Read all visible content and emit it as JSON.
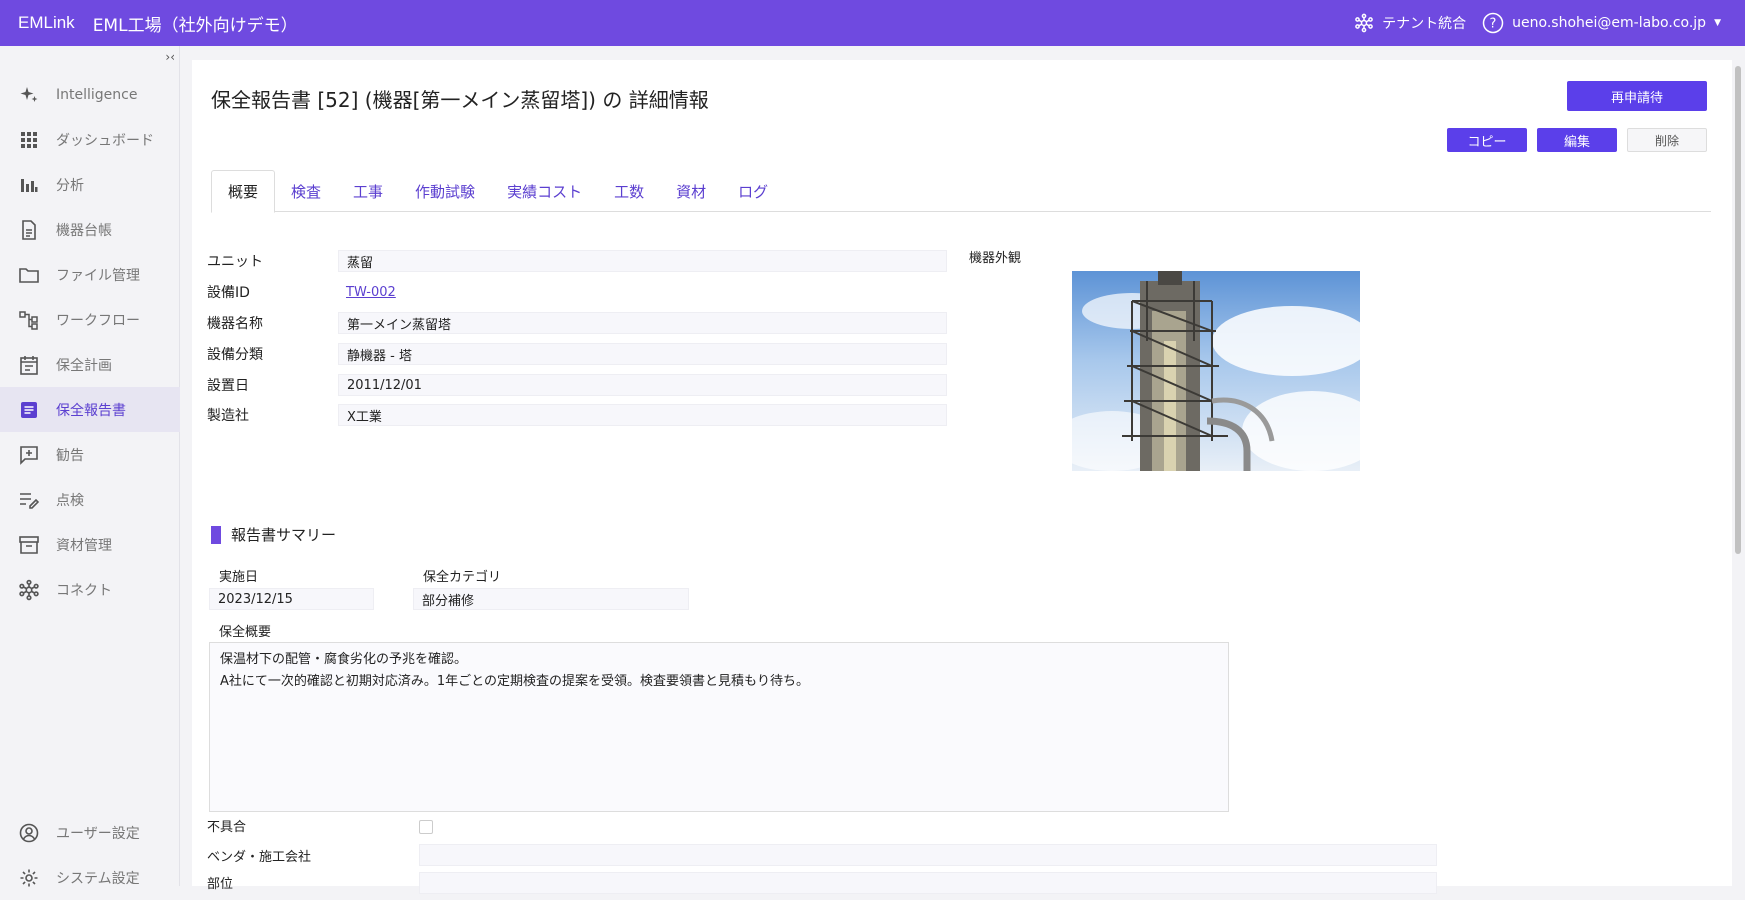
{
  "topbar": {
    "brand": "EMLink",
    "tenant": "EML工場（社外向けデモ）",
    "tenant_link": "テナント統合",
    "user": "ueno.shohei@em-labo.co.jp"
  },
  "sidebar": {
    "collapse": "››‹",
    "items": [
      {
        "label": "Intelligence",
        "icon": "sparkle-icon"
      },
      {
        "label": "ダッシュボード",
        "icon": "grid-icon"
      },
      {
        "label": "分析",
        "icon": "bar-chart-icon"
      },
      {
        "label": "機器台帳",
        "icon": "document-icon"
      },
      {
        "label": "ファイル管理",
        "icon": "folder-icon"
      },
      {
        "label": "ワークフロー",
        "icon": "workflow-icon"
      },
      {
        "label": "保全計画",
        "icon": "calendar-icon"
      },
      {
        "label": "保全報告書",
        "icon": "report-icon"
      },
      {
        "label": "勧告",
        "icon": "advice-icon"
      },
      {
        "label": "点検",
        "icon": "checklist-icon"
      },
      {
        "label": "資材管理",
        "icon": "archive-icon"
      },
      {
        "label": "コネクト",
        "icon": "hub-icon"
      }
    ],
    "bottom": [
      {
        "label": "ユーザー設定",
        "icon": "user-icon"
      },
      {
        "label": "システム設定",
        "icon": "gear-icon"
      }
    ]
  },
  "page": {
    "title": "保全報告書 [52] (機器[第一メイン蒸留塔]) の 詳細情報",
    "btn_reapply": "再申請待",
    "btn_copy": "コピー",
    "btn_edit": "編集",
    "btn_delete": "削除"
  },
  "tabs": [
    "概要",
    "検査",
    "工事",
    "作動試験",
    "実績コスト",
    "工数",
    "資材",
    "ログ"
  ],
  "overview": {
    "fields": [
      {
        "label": "ユニット",
        "value": "蒸留"
      },
      {
        "label": "設備ID",
        "value": "TW-002"
      },
      {
        "label": "機器名称",
        "value": "第一メイン蒸留塔"
      },
      {
        "label": "設備分類",
        "value": "静機器 - 塔"
      },
      {
        "label": "設置日",
        "value": "2011/12/01"
      },
      {
        "label": "製造社",
        "value": "X工業"
      }
    ],
    "photo_label": "機器外観"
  },
  "summary": {
    "title": "報告書サマリー",
    "date_label": "実施日",
    "date": "2023/12/15",
    "category_label": "保全カテゴリ",
    "category": "部分補修",
    "overview_label": "保全概要",
    "overview_line1": "保温材下の配管・腐食劣化の予兆を確認。",
    "overview_line2": "A社にて一次的確認と初期対応済み。1年ごとの定期検査の提案を受領。検査要領書と見積もり待ち。",
    "defect_label": "不具合",
    "vendor_label": "ベンダ・施工会社",
    "part_label": "部位"
  }
}
